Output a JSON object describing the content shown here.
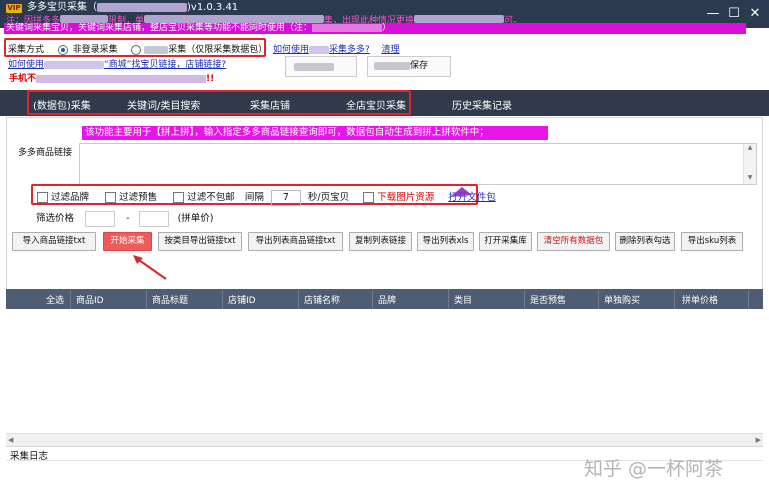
{
  "window": {
    "badge": "VIP",
    "title": "多多宝贝采集（",
    "version": ")v1.0.3.41",
    "minimize_label": "—",
    "maximize_label": "☐",
    "close_label": "✕"
  },
  "notices": {
    "line1_a": "注：因拼多多",
    "line1_b": "限制，单",
    "line1_c": "集，出现此种情况更换",
    "line1_d": "可。",
    "line2_a": "关键词采集宝贝，关键词采集店铺，整店宝贝采集等功能不能同时使用（注：",
    "line2_b": "）"
  },
  "collect_mode": {
    "label": "采集方式",
    "option1": "非登录采集",
    "option2": "采集（仅限采集数据包）",
    "selected": "option1"
  },
  "links": {
    "howto_use": "如何使用",
    "multi_collect": "采集多多?",
    "clear": "清理",
    "howto_find": "如何使用",
    "mall_find": "“商城”找宝贝链接，店铺链接?",
    "save_btn": "保存"
  },
  "phone_line": {
    "a": "手机不",
    "b": "!!"
  },
  "tabs": [
    {
      "label": "(数据包)采集",
      "active": true
    },
    {
      "label": "关键词/类目搜索",
      "active": false
    },
    {
      "label": "采集店铺",
      "active": false
    },
    {
      "label": "全店宝贝采集",
      "active": false
    },
    {
      "label": "历史采集记录",
      "active": false
    }
  ],
  "main": {
    "info_banner": "该功能主要用于【拼上拼】，输入指定多多商品链接查询即可，数据包自动生成到拼上拼软件中；",
    "links_label": "多多商品链接",
    "links_value": ""
  },
  "filters": {
    "filter_brand": "过滤品牌",
    "filter_presale": "过滤预售",
    "filter_free_ship": "过滤不包邮",
    "interval_label": "间隔",
    "interval_value": "7",
    "interval_unit": "秒/页宝贝",
    "download_images": "下载图片资源",
    "open_folder": "打开文件包",
    "price_label": "筛选价格",
    "price_min": "",
    "price_sep": "-",
    "price_max": "",
    "price_note": "(拼单价)"
  },
  "buttons": {
    "import_txt": "导入商品链接txt",
    "start": "开始采集",
    "category_export": "按类目导出链接txt",
    "export_list_links": "导出列表商品链接txt",
    "copy_list_links": "复制列表链接",
    "export_xls": "导出列表xls",
    "open_library": "打开采集库",
    "clear_packages": "清空所有数据包",
    "delete_checked": "删除列表勾选",
    "export_sku": "导出sku列表"
  },
  "table": {
    "columns": [
      "全选",
      "商品ID",
      "商品标题",
      "店铺ID",
      "店铺名称",
      "品牌",
      "类目",
      "是否预售",
      "单独购买",
      "拼单价格"
    ],
    "rows": []
  },
  "log": {
    "label": "采集日志"
  },
  "watermark": {
    "text": "知乎 @一杯阿茶"
  },
  "colors": {
    "title_bar": "#2b3a4e",
    "tab_bar": "#303a4a",
    "notice_magenta": "#d90fd9",
    "highlight_red": "#e0242b",
    "start_button": "#ef5a5a",
    "header_row": "#4e5d72"
  }
}
